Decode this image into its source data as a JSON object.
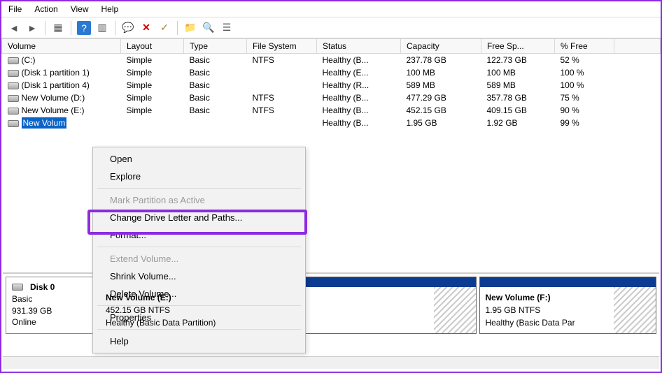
{
  "menu": {
    "file": "File",
    "action": "Action",
    "view": "View",
    "help": "Help"
  },
  "toolbar": {
    "back": "◄",
    "forward": "►",
    "table": "▦",
    "help": "?",
    "schedule": "▥",
    "chat": "💬",
    "close": "✕",
    "check": "✓",
    "folder_up": "📁",
    "search": "🔍",
    "list": "☰"
  },
  "columns": {
    "volume": "Volume",
    "layout": "Layout",
    "type": "Type",
    "fs": "File System",
    "status": "Status",
    "capacity": "Capacity",
    "free": "Free Sp...",
    "pctfree": "% Free"
  },
  "rows": [
    {
      "vol": "(C:)",
      "layout": "Simple",
      "type": "Basic",
      "fs": "NTFS",
      "status": "Healthy (B...",
      "cap": "237.78 GB",
      "free": "122.73 GB",
      "pct": "52 %"
    },
    {
      "vol": "(Disk 1 partition 1)",
      "layout": "Simple",
      "type": "Basic",
      "fs": "",
      "status": "Healthy (E...",
      "cap": "100 MB",
      "free": "100 MB",
      "pct": "100 %"
    },
    {
      "vol": "(Disk 1 partition 4)",
      "layout": "Simple",
      "type": "Basic",
      "fs": "",
      "status": "Healthy (R...",
      "cap": "589 MB",
      "free": "589 MB",
      "pct": "100 %"
    },
    {
      "vol": "New Volume (D:)",
      "layout": "Simple",
      "type": "Basic",
      "fs": "NTFS",
      "status": "Healthy (B...",
      "cap": "477.29 GB",
      "free": "357.78 GB",
      "pct": "75 %"
    },
    {
      "vol": "New Volume (E:)",
      "layout": "Simple",
      "type": "Basic",
      "fs": "NTFS",
      "status": "Healthy (B...",
      "cap": "452.15 GB",
      "free": "409.15 GB",
      "pct": "90 %"
    },
    {
      "vol": "New Volum",
      "layout": "",
      "type": "",
      "fs": "",
      "status": "Healthy (B...",
      "cap": "1.95 GB",
      "free": "1.92 GB",
      "pct": "99 %",
      "selected": true
    }
  ],
  "contextmenu": {
    "open": "Open",
    "explore": "Explore",
    "markactive": "Mark Partition as Active",
    "change": "Change Drive Letter and Paths...",
    "format": "Format...",
    "extend": "Extend Volume...",
    "shrink": "Shrink Volume...",
    "delete": "Delete Volume...",
    "properties": "Properties",
    "help": "Help"
  },
  "disk": {
    "label": "Disk 0",
    "type": "Basic",
    "size": "931.39 GB",
    "status": "Online",
    "volE": {
      "title": "New Volume  (E:)",
      "line1": "452.15 GB NTFS",
      "line2": "Healthy (Basic Data Partition)"
    },
    "volF": {
      "title": "New Volume  (F:)",
      "line1": "1.95 GB NTFS",
      "line2": "Healthy (Basic Data Par"
    }
  }
}
